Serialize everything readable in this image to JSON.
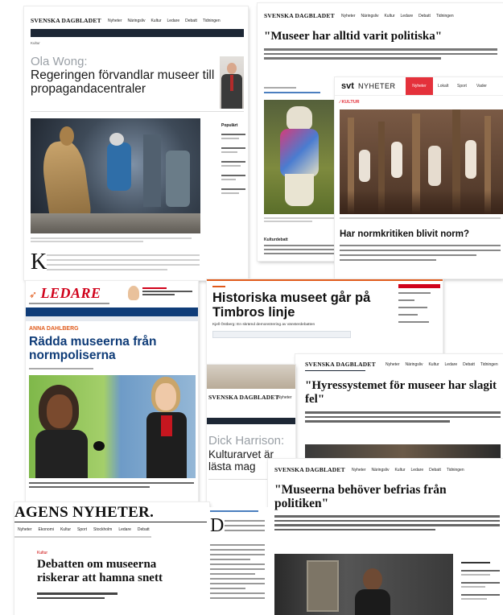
{
  "clip1": {
    "logo": "SVENSKA DAGBLADET",
    "nav": [
      "Nyheter",
      "Näringsliv",
      "Kultur",
      "Ledare",
      "Debatt",
      "Tidningen"
    ],
    "section": "Kultur",
    "author": "Ola Wong:",
    "headline": "Regeringen förvandlar museer till propagandacentraler",
    "dropcap": "K",
    "sidebar_title": "Populärt"
  },
  "clip2": {
    "logo": "SVENSKA DAGBLADET",
    "nav": [
      "Nyheter",
      "Näringsliv",
      "Kultur",
      "Ledare",
      "Debatt",
      "Tidningen"
    ],
    "headline": "\"Museer har alltid varit politiska\"",
    "section": "Kulturdebatt"
  },
  "clip3": {
    "logo_symbol": "svt",
    "logo_text": "NYHETER",
    "nav": [
      "Nyheter",
      "Lokalt",
      "Sport",
      "Vader"
    ],
    "section": "KULTUR",
    "headline": "Har normkritiken blivit norm?"
  },
  "clip4": {
    "logo": "LEDARE",
    "author": "ANNA DAHLBERG",
    "headline": "Rädda museerna från normpoliserna"
  },
  "clip5": {
    "headline": "Historiska museet går på Timbros linje",
    "byline": "Kjell Östberg: En skrämd demonstrering av vänsterdebatten"
  },
  "clip6": {
    "logo": "SVENSKA DAGBLADET",
    "nav": [
      "Nyheter",
      "Näringsliv",
      "Kultur",
      "Ledare",
      "Debatt",
      "Tidningen"
    ],
    "headline": "\"Hyressystemet för museer har slagit fel\""
  },
  "clip7": {
    "logo": "SVENSKA DAGBLADET",
    "nav": [
      "Nyheter",
      "Nä"
    ],
    "author": "Dick Harrison:",
    "headline": "Kulturarvet är lästa mag"
  },
  "clip8": {
    "logo": "SVENSKA DAGBLADET",
    "nav": [
      "Nyheter",
      "Näringsliv",
      "Kultur",
      "Ledare",
      "Debatt",
      "Tidningen"
    ],
    "headline": "\"Museerna behöver befrias från politiken\""
  },
  "clip9": {
    "logo": "AGENS NYHETER.",
    "nav": [
      "Nyheter",
      "Ekonomi",
      "Kultur",
      "Sport",
      "Stockholm",
      "Ledare",
      "Debatt"
    ],
    "section": "Kultur",
    "headline": "Debatten om museerna riskerar att hamna snett",
    "dropcap": "D"
  },
  "colors": {
    "dn_blue": "#0f3c78",
    "svt_red": "#e4313b",
    "accent_orange": "#e05a1b"
  }
}
